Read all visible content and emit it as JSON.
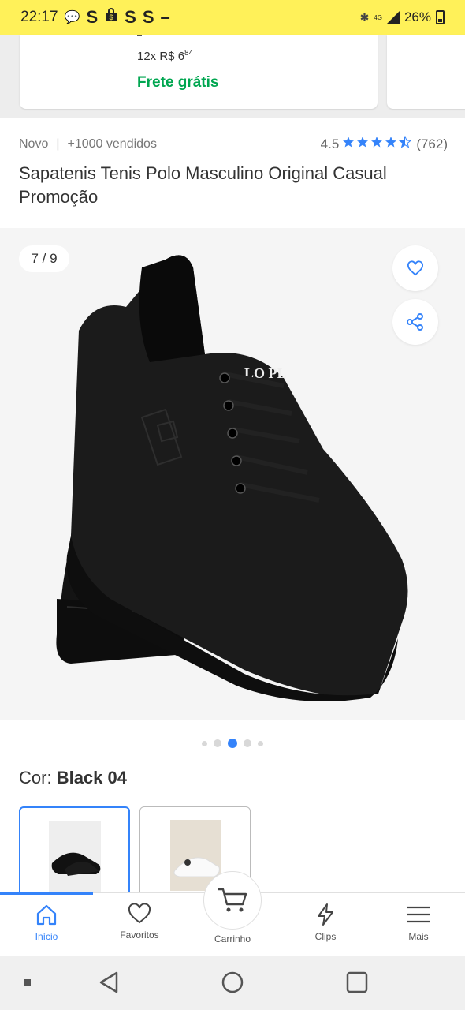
{
  "status_bar": {
    "time": "22:17",
    "notif_icons": [
      "chat-icon",
      "S",
      "shopping-bag-icon",
      "S",
      "S",
      "–"
    ],
    "signal_label": "4G",
    "battery": "26%"
  },
  "top_card": {
    "installments_prefix": "12x R$ 6",
    "installments_cents": "84",
    "shipping": "Frete grátis"
  },
  "product": {
    "condition": "Novo",
    "sold": "+1000 vendidos",
    "rating": "4.5",
    "rating_stars": 4.5,
    "reviews": "(762)",
    "title": "Sapatenis Tenis Polo Masculino Original Casual Promoção"
  },
  "gallery": {
    "counter": "7 / 9",
    "logo_text": "LO PL",
    "dots_total": 5,
    "dots_active_index": 2
  },
  "color": {
    "label": "Cor:",
    "value": "Black 04"
  },
  "bottom_nav": {
    "items": [
      {
        "label": "Início",
        "icon": "home-icon",
        "active": true
      },
      {
        "label": "Favoritos",
        "icon": "heart-icon",
        "active": false
      },
      {
        "label": "Carrinho",
        "icon": "cart-icon",
        "active": false
      },
      {
        "label": "Clips",
        "icon": "lightning-icon",
        "active": false
      },
      {
        "label": "Mais",
        "icon": "menu-icon",
        "active": false
      }
    ]
  },
  "colors": {
    "brand_yellow": "#fff159",
    "accent_blue": "#3483fa",
    "shipping_green": "#00a650"
  }
}
